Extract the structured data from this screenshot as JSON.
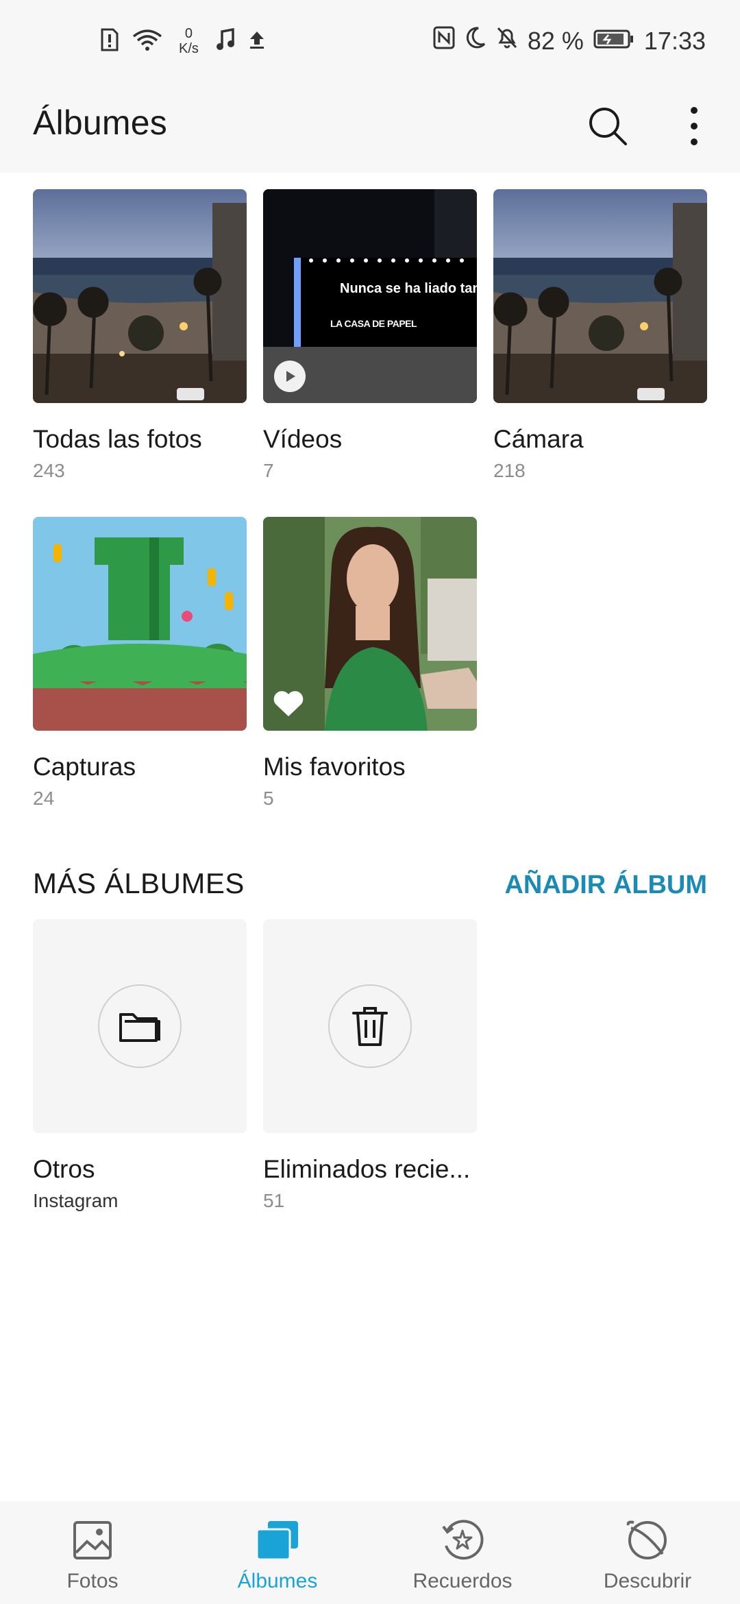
{
  "status_bar": {
    "speed_value": "0",
    "speed_unit": "K/s",
    "battery": "82 %",
    "time": "17:33"
  },
  "header": {
    "title": "Álbumes"
  },
  "albums": [
    {
      "name": "Todas las fotos",
      "count": "243"
    },
    {
      "name": "Vídeos",
      "count": "7"
    },
    {
      "name": "Cámara",
      "count": "218"
    },
    {
      "name": "Capturas",
      "count": "24"
    },
    {
      "name": "Mis favoritos",
      "count": "5"
    }
  ],
  "video_thumb_text": {
    "billboard": "Nunca se ha liado tan",
    "brand": "LA CASA DE PAPEL"
  },
  "more_albums": {
    "title": "MÁS ÁLBUMES",
    "add_label": "AÑADIR ÁLBUM",
    "items": [
      {
        "name": "Otros",
        "subtitle": "Instagram",
        "icon": "folder-icon"
      },
      {
        "name": "Eliminados recie...",
        "count": "51",
        "icon": "trash-icon"
      }
    ]
  },
  "bottom_nav": {
    "items": [
      {
        "label": "Fotos",
        "icon": "photo-icon"
      },
      {
        "label": "Álbumes",
        "icon": "albums-icon",
        "active": true
      },
      {
        "label": "Recuerdos",
        "icon": "memories-icon"
      },
      {
        "label": "Descubrir",
        "icon": "discover-icon"
      }
    ]
  },
  "colors": {
    "accent": "#1a8bb5",
    "active_nav": "#1aa3d6",
    "background": "#ffffff",
    "bar_background": "#f7f7f7"
  }
}
